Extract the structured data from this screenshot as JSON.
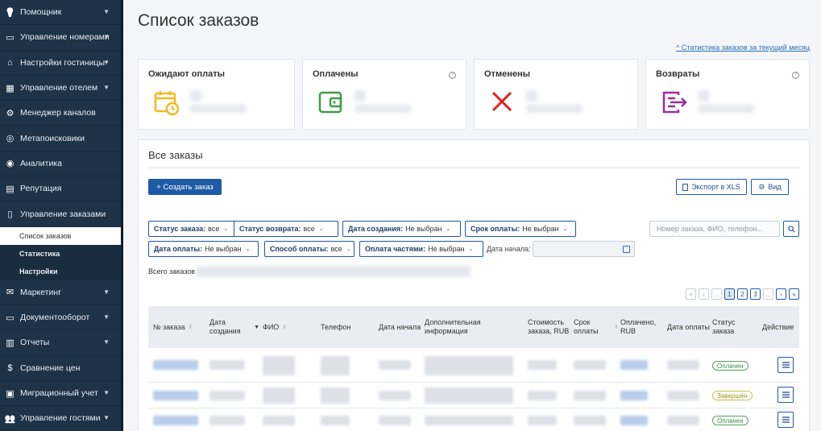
{
  "sidebar": {
    "items": [
      {
        "label": "Помощник",
        "icon": "bulb-icon",
        "chevron": true
      },
      {
        "label": "Управление номерами",
        "icon": "door-icon",
        "chevron": true
      },
      {
        "label": "Настройки гостиницы",
        "icon": "home-icon",
        "chevron": true
      },
      {
        "label": "Управление отелем",
        "icon": "grid-icon",
        "chevron": true
      },
      {
        "label": "Менеджер каналов",
        "icon": "gear-icon",
        "chevron": false
      },
      {
        "label": "Метапоисковики",
        "icon": "search-icon",
        "chevron": false
      },
      {
        "label": "Аналитика",
        "icon": "target-icon",
        "chevron": false
      },
      {
        "label": "Репутация",
        "icon": "chat-icon",
        "chevron": false
      },
      {
        "label": "Управление заказами",
        "icon": "document-icon",
        "chevron": false
      }
    ],
    "subitems": [
      {
        "label": "Список заказов"
      },
      {
        "label": "Статистика"
      },
      {
        "label": "Настройки"
      }
    ],
    "items2": [
      {
        "label": "Маркетинг",
        "icon": "mail-icon",
        "chevron": true
      },
      {
        "label": "Документооборот",
        "icon": "folder-icon",
        "chevron": true
      },
      {
        "label": "Отчеты",
        "icon": "chart-icon",
        "chevron": true
      },
      {
        "label": "Сравнение цен",
        "icon": "dollar-icon",
        "chevron": false
      },
      {
        "label": "Миграционный учет",
        "icon": "id-card-icon",
        "chevron": true
      },
      {
        "label": "Управление гостями",
        "icon": "users-icon",
        "chevron": true
      }
    ]
  },
  "header": {
    "title": "Список заказов",
    "stats_link": "^ Статистика заказов за текущий месяц"
  },
  "cards": [
    {
      "title": "Ожидают оплаты",
      "icon": "calendar-clock-icon",
      "color": "#f5b820",
      "help": false
    },
    {
      "title": "Оплачены",
      "icon": "wallet-icon",
      "color": "#3f9e49",
      "help": true
    },
    {
      "title": "Отменены",
      "icon": "cross-icon",
      "color": "#e02020",
      "help": false
    },
    {
      "title": "Возвраты",
      "icon": "return-icon",
      "color": "#9b2f9b",
      "help": true
    }
  ],
  "orders": {
    "title": "Все заказы",
    "create_button": "+ Создать заказ",
    "export_button": "Экспорт в XLS",
    "view_button": "Вид",
    "filters_row1": [
      {
        "key": "Статус заказа:",
        "value": "все"
      },
      {
        "key": "Статус возврата:",
        "value": "все"
      },
      {
        "key": "Дата создания:",
        "value": "Не выбран"
      },
      {
        "key": "Срок оплаты:",
        "value": "Не выбран"
      }
    ],
    "filters_row2": [
      {
        "key": "Дата оплаты:",
        "value": "Не выбран"
      },
      {
        "key": "Способ оплаты:",
        "value": "все"
      },
      {
        "key": "Оплата частями:",
        "value": "Не выбран"
      }
    ],
    "search_placeholder": "Номер заказа, ФИО, телефон...",
    "date_start_label": "Дата начала:",
    "total_label": "Всего заказов",
    "pager": [
      "«",
      "‹",
      "...",
      "1",
      "2",
      "3",
      "...",
      "›",
      "»"
    ],
    "columns": [
      "№ заказа",
      "Дата создания",
      "ФИО",
      "Телефон",
      "Дата начала",
      "Дополнительная информация",
      "Стоимость заказа, RUB",
      "Срок оплаты",
      "Оплачено, RUB",
      "Дата оплаты",
      "Статус заказа",
      "Действие"
    ],
    "rows": [
      {
        "status": "Оплачен",
        "status_color": "green"
      },
      {
        "status": "Завершён",
        "status_color": "yellow"
      },
      {
        "status": "Оплачен",
        "status_color": "green"
      }
    ]
  },
  "colors": {
    "accent": "#1f5aa6",
    "sidebar_bg": "#1e3248"
  }
}
